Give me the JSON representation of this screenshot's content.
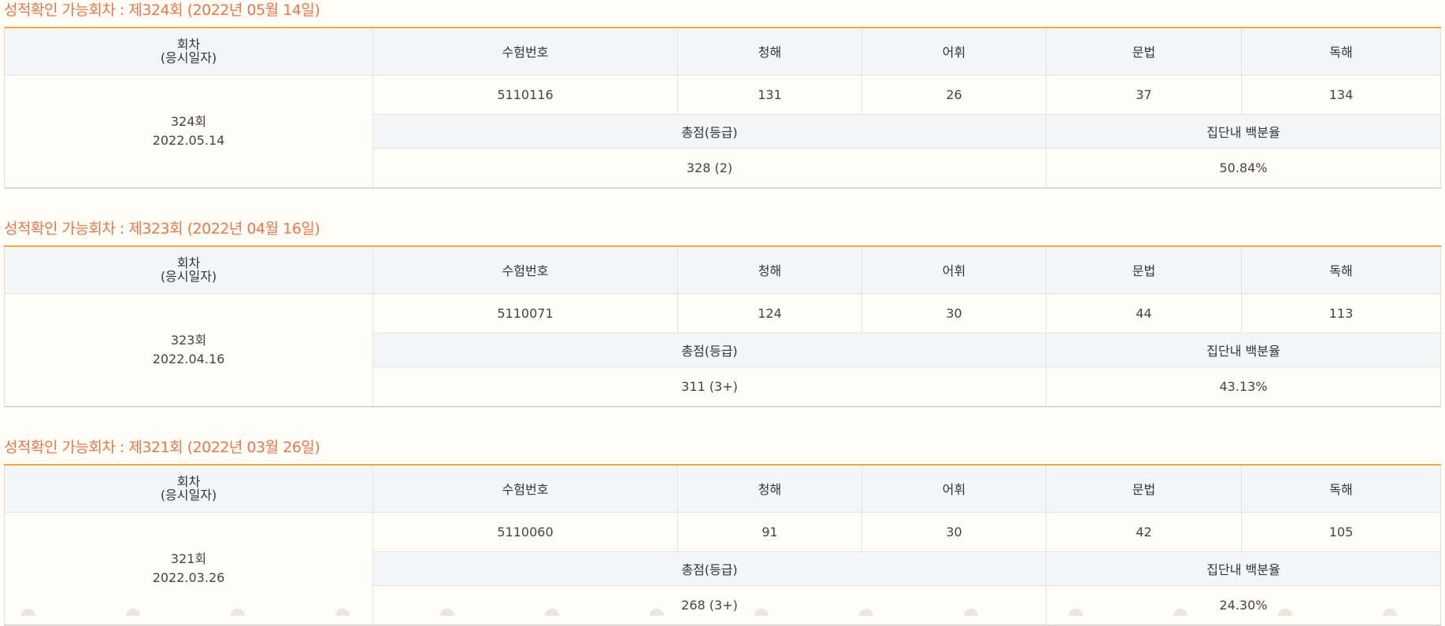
{
  "headers": {
    "round": "회차",
    "round_sub": "(응시일자)",
    "exam_no": "수험번호",
    "listening": "청해",
    "vocab": "어휘",
    "grammar": "문법",
    "reading": "독해",
    "total": "총점(등급)",
    "percentile": "집단내 백분율"
  },
  "sections": [
    {
      "title": "성적확인 가능회차 : 제324회 (2022년 05월 14일)",
      "round": "324회",
      "date": "2022.05.14",
      "exam_no": "5110116",
      "listening": "131",
      "vocab": "26",
      "grammar": "37",
      "reading": "134",
      "total": "328 (2)",
      "percentile": "50.84%"
    },
    {
      "title": "성적확인 가능회차 : 제323회 (2022년 04월 16일)",
      "round": "323회",
      "date": "2022.04.16",
      "exam_no": "5110071",
      "listening": "124",
      "vocab": "30",
      "grammar": "44",
      "reading": "113",
      "total": "311 (3+)",
      "percentile": "43.13%"
    },
    {
      "title": "성적확인 가능회차 : 제321회 (2022년 03월 26일)",
      "round": "321회",
      "date": "2022.03.26",
      "exam_no": "5110060",
      "listening": "91",
      "vocab": "30",
      "grammar": "42",
      "reading": "105",
      "total": "268 (3+)",
      "percentile": "24.30%"
    }
  ]
}
